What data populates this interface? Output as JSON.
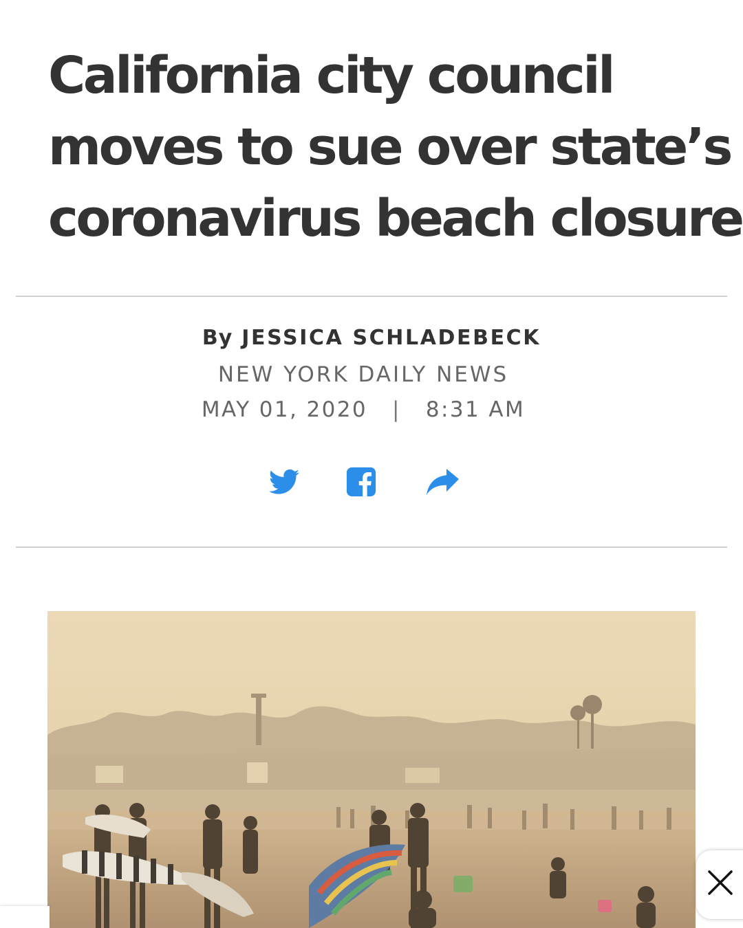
{
  "article": {
    "headline_lines": [
      "California city council",
      "moves to sue over state’s",
      "coronavirus beach closures"
    ],
    "byline_prefix": "By",
    "author": "JESSICA SCHLADEBECK",
    "publication": "NEW YORK DAILY NEWS",
    "date": "MAY 01, 2020",
    "separator": "|",
    "time": "8:31 AM"
  },
  "share": {
    "icons": [
      "twitter-icon",
      "facebook-icon",
      "share-arrow-icon"
    ],
    "color": "#2b8ee8"
  },
  "ui": {
    "close_icon": "close-icon"
  }
}
